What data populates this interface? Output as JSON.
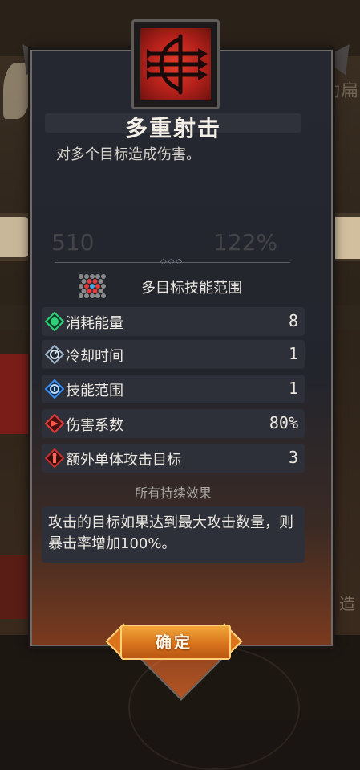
{
  "skill": {
    "name": "多重射击",
    "description": "对多个目标造成伤害。",
    "icon": "trident-arrows-icon"
  },
  "range": {
    "label": "多目标技能范围",
    "icon": "hex-grid-range-icon"
  },
  "stats": [
    {
      "label": "消耗能量",
      "value": "8",
      "icon": "energy-diamond-icon",
      "color": "#2fd07a"
    },
    {
      "label": "冷却时间",
      "value": "1",
      "icon": "cooldown-clock-icon",
      "color": "#9fb4c8"
    },
    {
      "label": "技能范围",
      "value": "1",
      "icon": "range-target-icon",
      "color": "#3a8ff0"
    },
    {
      "label": "伤害系数",
      "value": "80%",
      "icon": "damage-sword-icon",
      "color": "#e03a3a"
    },
    {
      "label": "额外单体攻击目标",
      "value": "3",
      "icon": "extra-target-icon",
      "color": "#c9302c"
    }
  ],
  "effects": {
    "title": "所有持续效果",
    "text": "攻击的目标如果达到最大攻击数量，则暴击率增加100%。"
  },
  "background": {
    "side_text_top": "戈为扁",
    "side_text_bottom": "，造",
    "stat_left": "510",
    "stat_right": "122%"
  },
  "confirm_label": "确定"
}
